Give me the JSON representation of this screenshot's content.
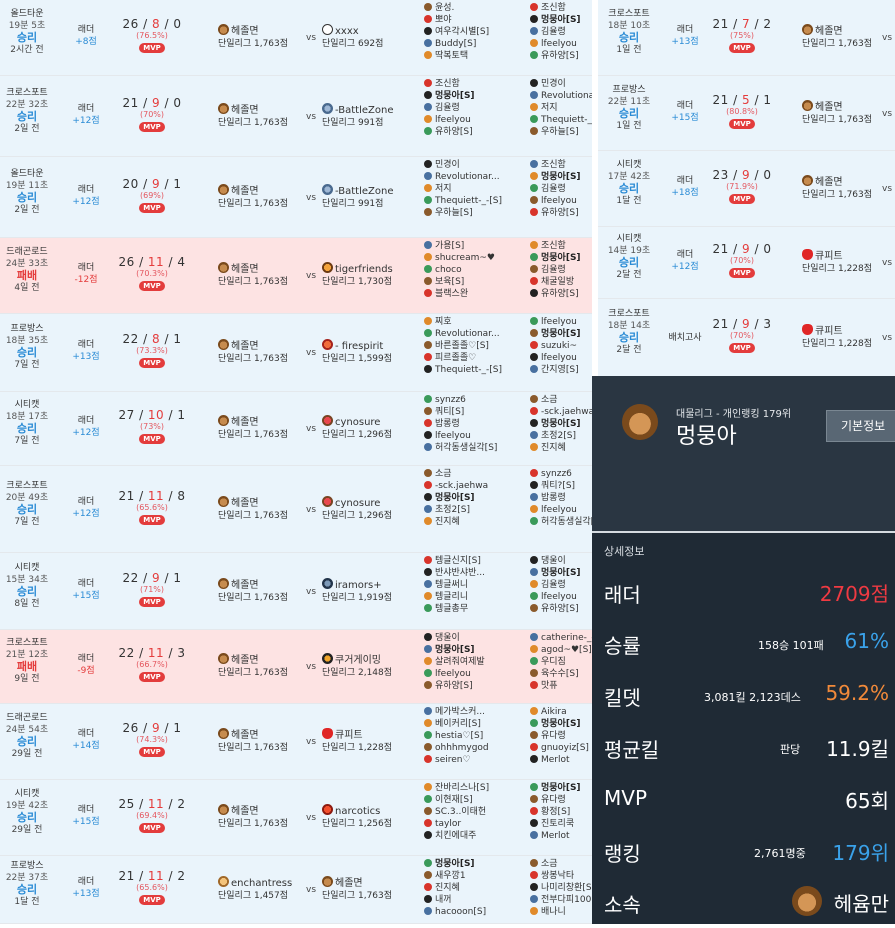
{
  "matches_left": [
    {
      "map": "올드타운",
      "dur": "19분 5초",
      "res": "승리",
      "ago": "2시간 전",
      "mode": "래더",
      "delta": "+8점",
      "k": "26",
      "d": "8",
      "a": "0",
      "kp": "(76.5%)",
      "mvp": "MVP",
      "p1": "헤졸면",
      "p1s": "단일리그 1,763점",
      "p2": "xxxx",
      "p2s": "단일리그 692점",
      "teamA": [
        "윤성.",
        "뽀야",
        "여우각시별[S]",
        "Buddy[S]",
        "딱복토택"
      ],
      "teamB": [
        "조신함",
        "멍뭉아[S]",
        "김율령",
        "lfeelyou",
        "유하양[S]"
      ]
    },
    {
      "map": "크로스포트",
      "dur": "22분 32초",
      "res": "승리",
      "ago": "2일 전",
      "mode": "래더",
      "delta": "+12점",
      "k": "21",
      "d": "9",
      "a": "0",
      "kp": "(70%)",
      "mvp": "MVP",
      "p1": "헤졸면",
      "p1s": "단일리그 1,763점",
      "p2": "-BattleZone",
      "p2s": "단일리그 991점",
      "teamA": [
        "조신함",
        "멍뭉아[S]",
        "김율령",
        "lfeelyou",
        "유하양[S]"
      ],
      "teamB": [
        "민경이",
        "Revolutionar...",
        "저지",
        "Thequiett-_-[S]",
        "우하늘[S]"
      ]
    },
    {
      "map": "올드타운",
      "dur": "19분 11초",
      "res": "승리",
      "ago": "2일 전",
      "mode": "래더",
      "delta": "+12점",
      "k": "20",
      "d": "9",
      "a": "1",
      "kp": "(69%)",
      "mvp": "MVP",
      "p1": "헤졸면",
      "p1s": "단일리그 1,763점",
      "p2": "-BattleZone",
      "p2s": "단일리그 991점",
      "teamA": [
        "민경이",
        "Revolutionar...",
        "저지",
        "Thequiett-_-[S]",
        "우하늘[S]"
      ],
      "teamB": [
        "조신함",
        "멍뭉아[S]",
        "김율령",
        "lfeelyou",
        "유하양[S]"
      ]
    },
    {
      "map": "드래곤로드",
      "dur": "24분 33초",
      "res": "패배",
      "ago": "4일 전",
      "mode": "래더",
      "delta": "-12점",
      "k": "26",
      "d": "11",
      "a": "4",
      "kp": "(70.3%)",
      "mvp": "MVP",
      "p1": "헤졸면",
      "p1s": "단일리그 1,763점",
      "p2": "tigerfriends",
      "p2s": "단일리그 1,730점",
      "teamA": [
        "가용[S]",
        "shucream~♥",
        "choco",
        "보육[S]",
        "블랙스완"
      ],
      "teamB": [
        "조신함",
        "멍뭉아[S]",
        "김율령",
        "채굴일방",
        "유하양[S]"
      ]
    },
    {
      "map": "프로방스",
      "dur": "18분 35초",
      "res": "승리",
      "ago": "7일 전",
      "mode": "래더",
      "delta": "+13점",
      "k": "22",
      "d": "8",
      "a": "1",
      "kp": "(73.3%)",
      "mvp": "MVP",
      "p1": "헤졸면",
      "p1s": "단일리그 1,763점",
      "p2": "- firespirit",
      "p2s": "단일리그 1,599점",
      "teamA": [
        "찌호",
        "Revolutionar...",
        "바른졸졸♡[S]",
        "피르졸졸♡",
        "Thequiett-_-[S]"
      ],
      "teamB": [
        "lfeelyou",
        "멍뭉아[S]",
        "suzuki~",
        "lfeelyou",
        "간지영[S]"
      ]
    },
    {
      "map": "시티캣",
      "dur": "18분 17초",
      "res": "승리",
      "ago": "7일 전",
      "mode": "래더",
      "delta": "+12점",
      "k": "27",
      "d": "10",
      "a": "1",
      "kp": "(73%)",
      "mvp": "MVP",
      "p1": "헤졸면",
      "p1s": "단일리그 1,763점",
      "p2": "cynosure",
      "p2s": "단일리그 1,296점",
      "teamA": [
        "synzz6",
        "쿼티[S]",
        "밥롱령",
        "lfeelyou",
        "허각동생실각[S]"
      ],
      "teamB": [
        "소금",
        "-sck.jaehwa",
        "멍뭉아[S]",
        "초정2[S]",
        "진지혜"
      ]
    },
    {
      "map": "크로스포트",
      "dur": "20분 49초",
      "res": "승리",
      "ago": "7일 전",
      "mode": "래더",
      "delta": "+12점",
      "k": "21",
      "d": "11",
      "a": "8",
      "kp": "(65.6%)",
      "mvp": "MVP",
      "p1": "헤졸면",
      "p1s": "단일리그 1,763점",
      "p2": "cynosure",
      "p2s": "단일리그 1,296점",
      "teamA": [
        "소금",
        "-sck.jaehwa",
        "멍뭉아[S]",
        "초정2[S]",
        "진지혜"
      ],
      "teamB": [
        "synzz6",
        "쿼티?[S]",
        "밥롱령",
        "lfeelyou",
        "허각동생실각[S]"
      ]
    },
    {
      "map": "시티캣",
      "dur": "15분 34초",
      "res": "승리",
      "ago": "8일 전",
      "mode": "래더",
      "delta": "+15점",
      "k": "22",
      "d": "9",
      "a": "1",
      "kp": "(71%)",
      "mvp": "MVP",
      "p1": "헤졸면",
      "p1s": "단일리그 1,763점",
      "p2": "iramors+",
      "p2s": "단일리그 1,919점",
      "teamA": [
        "텡글신지[S]",
        "반샤반샤반...",
        "텡글써니",
        "텡글리니",
        "텡글총무"
      ],
      "teamB": [
        "댕울이",
        "멍뭉아[S]",
        "김율령",
        "lfeelyou",
        "유하양[S]"
      ]
    },
    {
      "map": "크로스포트",
      "dur": "21분 12초",
      "res": "패배",
      "ago": "9일 전",
      "mode": "래더",
      "delta": "-9점",
      "k": "22",
      "d": "11",
      "a": "3",
      "kp": "(66.7%)",
      "mvp": "MVP",
      "p1": "헤졸면",
      "p1s": "단일리그 1,763점",
      "p2": "쿠거게이밍",
      "p2s": "단일리그 2,148점",
      "teamA": [
        "댕울이",
        "멍뭉아[S]",
        "살려줘여제발",
        "lfeelyou",
        "유하양[S]"
      ],
      "teamB": [
        "catherine-_-",
        "agod~♥[S]",
        "우디짐",
        "육수수[S]",
        "맛퓨"
      ]
    },
    {
      "map": "드래곤로드",
      "dur": "24분 54초",
      "res": "승리",
      "ago": "29일 전",
      "mode": "래더",
      "delta": "+14점",
      "k": "26",
      "d": "9",
      "a": "1",
      "kp": "(74.3%)",
      "mvp": "MVP",
      "p1": "헤졸면",
      "p1s": "단일리그 1,763점",
      "p2": "큐피트",
      "p2s": "단일리그 1,228점",
      "teamA": [
        "메가박스커...",
        "베이커리[S]",
        "hestia♡[S]",
        "ohhhmygod",
        "seiren♡"
      ],
      "teamB": [
        "Aikira",
        "멍뭉아[S]",
        "유다령",
        "gnuoyiz[S]",
        "Merlot"
      ]
    },
    {
      "map": "시티캣",
      "dur": "19분 42초",
      "res": "승리",
      "ago": "29일 전",
      "mode": "래더",
      "delta": "+15점",
      "k": "25",
      "d": "11",
      "a": "2",
      "kp": "(69.4%)",
      "mvp": "MVP",
      "p1": "헤졸면",
      "p1s": "단일리그 1,763점",
      "p2": "narcotics",
      "p2s": "단일리그 1,256점",
      "teamA": [
        "잔바리스나[S]",
        "이현재[S]",
        "SC.3..이태헌",
        "taylor",
        "치킨에대주"
      ],
      "teamB": [
        "멍뭉아[S]",
        "유다령",
        "황정[S]",
        "진토리쿡",
        "Merlot"
      ]
    },
    {
      "map": "프로방스",
      "dur": "22분 37초",
      "res": "승리",
      "ago": "1달 전",
      "mode": "래더",
      "delta": "+13점",
      "k": "21",
      "d": "11",
      "a": "2",
      "kp": "(65.6%)",
      "mvp": "MVP",
      "p1": "enchantress",
      "p1s": "단일리그 1,457점",
      "p2": "헤졸면",
      "p2s": "단일리그 1,763점",
      "teamA": [
        "멍뭉아[S]",
        "새우깡1",
        "진지혜",
        "내꺼",
        "hacooon[S]"
      ],
      "teamB": [
        "소금",
        "쌍봉낙타",
        "나미리창환[S]",
        "전부다피100[S]",
        "배나니"
      ]
    }
  ],
  "matches_right": [
    {
      "map": "크로스포트",
      "dur": "18분 10초",
      "res": "승리",
      "ago": "1일 전",
      "mode": "래더",
      "delta": "+13점",
      "k": "21",
      "d": "7",
      "a": "2",
      "kp": "(75%)",
      "mvp": "MVP",
      "p1": "헤졸면",
      "p1s": "단일리그 1,763점",
      "vs": "vs"
    },
    {
      "map": "프로방스",
      "dur": "22분 11초",
      "res": "승리",
      "ago": "1일 전",
      "mode": "래더",
      "delta": "+15점",
      "k": "21",
      "d": "5",
      "a": "1",
      "kp": "(80.8%)",
      "mvp": "MVP",
      "p1": "헤졸면",
      "p1s": "단일리그 1,763점",
      "vs": "vs"
    },
    {
      "map": "시티캣",
      "dur": "17분 42초",
      "res": "승리",
      "ago": "1달 전",
      "mode": "래더",
      "delta": "+18점",
      "k": "23",
      "d": "9",
      "a": "0",
      "kp": "(71.9%)",
      "mvp": "MVP",
      "p1": "헤졸면",
      "p1s": "단일리그 1,763점",
      "vs": "vs"
    },
    {
      "map": "시티캣",
      "dur": "14분 19초",
      "res": "승리",
      "ago": "2달 전",
      "mode": "래더",
      "delta": "+12점",
      "k": "21",
      "d": "9",
      "a": "0",
      "kp": "(70%)",
      "mvp": "MVP",
      "p1": "큐피트",
      "p1s": "단일리그 1,228점",
      "vs": "vs"
    },
    {
      "map": "크로스포트",
      "dur": "18분 14초",
      "res": "승리",
      "ago": "2달 전",
      "mode": "배치고사",
      "delta": "",
      "k": "21",
      "d": "9",
      "a": "3",
      "kp": "(70%)",
      "mvp": "MVP",
      "p1": "큐피트",
      "p1s": "단일리그 1,228점",
      "vs": "vs"
    }
  ],
  "profile": {
    "rank": "대물리그 - 개인랭킹 179위",
    "name": "멍뭉아",
    "button": "기본정보",
    "detail_title": "상세정보",
    "stats": [
      {
        "label": "래더",
        "sub": "",
        "value": "2709점",
        "color": "#ef3a42"
      },
      {
        "label": "승률",
        "sub": "158승 101패",
        "value": "61%",
        "color": "#3aa2ea"
      },
      {
        "label": "킬뎃",
        "sub": "3,081킬 2,123데스",
        "value": "59.2%",
        "color": "#f28a3a"
      },
      {
        "label": "평균킬",
        "sub": "판당",
        "value": "11.9킬",
        "color": "#ffffff"
      },
      {
        "label": "MVP",
        "sub": "",
        "value": "65회",
        "color": "#ffffff"
      },
      {
        "label": "랭킹",
        "sub": "2,761명중",
        "value": "179위",
        "color": "#3aa2ea"
      },
      {
        "label": "소속",
        "sub": "",
        "value": "헤윰만",
        "color": "#ffffff"
      }
    ]
  },
  "vs_label": "vs"
}
